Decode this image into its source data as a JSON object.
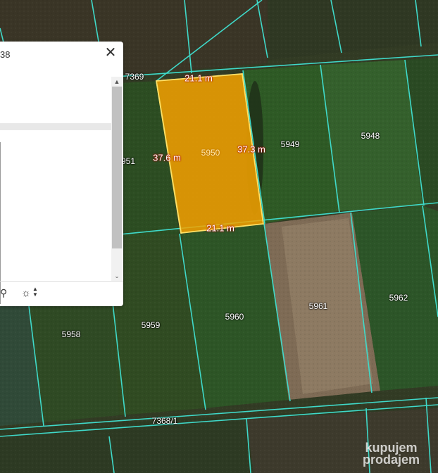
{
  "popup": {
    "title": "38",
    "close_icon": "close-icon",
    "footer_icons": [
      "pointer-icon",
      "brightness-icon",
      "up-down-arrows-icon"
    ]
  },
  "parcel_labels": {
    "p7369": "7369",
    "p5951": "951",
    "p5950": "5950",
    "p5949": "5949",
    "p5948": "5948",
    "p5958": "5958",
    "p5959": "5959",
    "p5960": "5960",
    "p5961": "5961",
    "p5962": "5962",
    "p7368": "7368/1"
  },
  "measurements": {
    "top": "21.1 m",
    "bottom": "21.1 m",
    "left": "37.6 m",
    "right": "37.3 m"
  },
  "watermark": {
    "line1": "kupujem",
    "line2": "prodajem"
  },
  "colors": {
    "parcel_line": "#3fd9c9",
    "selected_fill": "#f5a300",
    "selected_outline": "#ffe066"
  }
}
